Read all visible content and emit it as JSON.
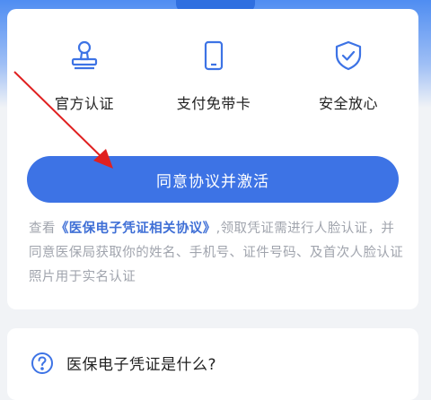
{
  "features": [
    {
      "label": "官方认证",
      "icon": "stamp-icon"
    },
    {
      "label": "支付免带卡",
      "icon": "phone-icon"
    },
    {
      "label": "安全放心",
      "icon": "shield-check-icon"
    }
  ],
  "activate_button": {
    "label": "同意协议并激活"
  },
  "notice": {
    "prefix": "查看",
    "link": "《医保电子凭证相关协议》",
    "suffix": ",领取凭证需进行人脸认证，并同意医保局获取你的姓名、手机号、证件号码、及首次人脸认证照片用于实名认证"
  },
  "faq": {
    "title": "医保电子凭证是什么?",
    "icon": "help-circle-icon"
  },
  "colors": {
    "accent": "#3d73e5",
    "link": "#3f6fd6",
    "annotation_arrow": "#e02020"
  }
}
